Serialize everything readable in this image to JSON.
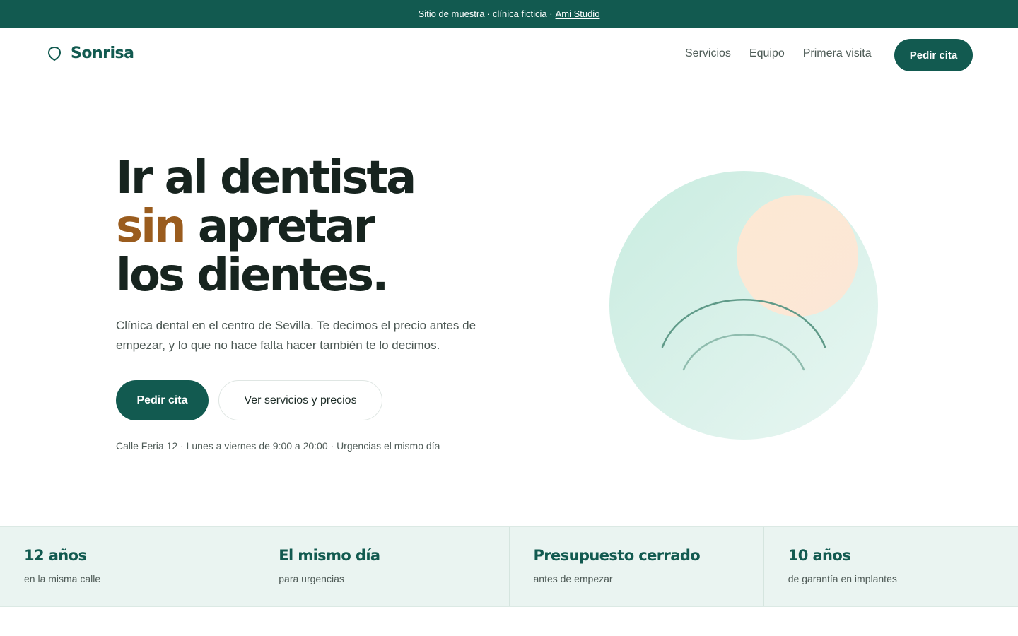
{
  "colors": {
    "brand": "#125a50",
    "accent": "#9a5c1e",
    "text": "#17241f",
    "stats_bg": "#eaf4f1",
    "mint": "#cdeee3",
    "peach": "#fbe7d3"
  },
  "announcement": {
    "text": "Sitio de muestra · clínica ficticia ·",
    "link": "Ami Studio"
  },
  "header": {
    "logo_icon": "tooth-icon",
    "brand": "Sonrisa",
    "nav": [
      "Servicios",
      "Equipo",
      "Primera visita"
    ],
    "cta": "Pedir cita"
  },
  "hero": {
    "title_line1": "Ir al dentista",
    "title_accent": "sin",
    "title_line2_rest": "apretar",
    "title_line3": "los dientes.",
    "description": "Clínica dental en el centro de Sevilla. Te decimos el precio antes de empezar, y lo que no hace falta hacer también te lo decimos.",
    "primary_button": "Pedir cita",
    "secondary_button": "Ver servicios y precios",
    "meta": "Calle Feria 12 · Lunes a viernes de 9:00 a 20:00 · Urgencias el mismo día"
  },
  "stats": [
    {
      "title": "12 años",
      "subtitle": "en la misma calle"
    },
    {
      "title": "El mismo día",
      "subtitle": "para urgencias"
    },
    {
      "title": "Presupuesto cerrado",
      "subtitle": "antes de empezar"
    },
    {
      "title": "10 años",
      "subtitle": "de garantía en implantes"
    }
  ]
}
